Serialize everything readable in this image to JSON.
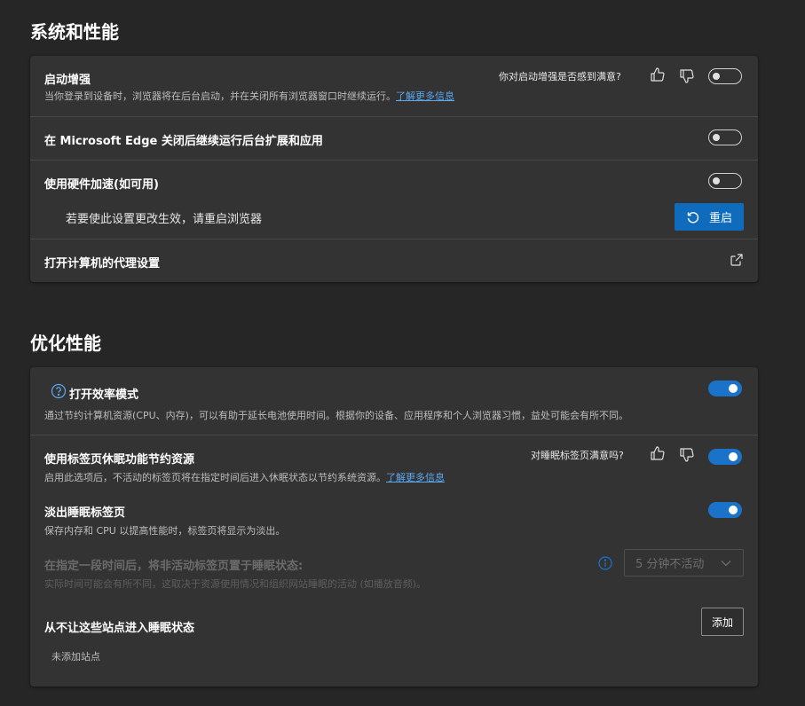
{
  "system": {
    "title": "系统和性能",
    "startup_boost": {
      "title": "启动增强",
      "desc": "当你登录到设备时，浏览器将在后台启动，并在关闭所有浏览器窗口时继续运行。",
      "learn_more": "了解更多信息",
      "feedback_question": "你对启动增强是否感到满意?",
      "toggle_state": "off"
    },
    "background_apps": {
      "title": "在 Microsoft Edge 关闭后继续运行后台扩展和应用",
      "toggle_state": "off"
    },
    "hardware_accel": {
      "title": "使用硬件加速(如可用)",
      "toggle_state": "off",
      "restart_note": "若要使此设置更改生效，请重启浏览器",
      "restart_label": "重启"
    },
    "proxy": {
      "title": "打开计算机的代理设置"
    }
  },
  "perf": {
    "title": "优化性能",
    "efficiency": {
      "title": "打开效率模式",
      "desc": "通过节约计算机资源(CPU、内存)，可以有助于延长电池使用时间。根据你的设备、应用程序和个人浏览器习惯，益处可能会有所不同。",
      "toggle_state": "on"
    },
    "sleeping_tabs": {
      "title": "使用标签页休眠功能节约资源",
      "desc": "启用此选项后，不活动的标签页将在指定时间后进入休眠状态以节约系统资源。",
      "learn_more": "了解更多信息",
      "feedback_question": "对睡眠标签页满意吗?",
      "toggle_state": "on"
    },
    "fade_tabs": {
      "title": "淡出睡眠标签页",
      "desc": "保存内存和 CPU 以提高性能时，标签页将显示为淡出。",
      "toggle_state": "on"
    },
    "sleep_after": {
      "title": "在指定一段时间后，将非活动标签页置于睡眠状态:",
      "desc": "实际时间可能会有所不同，这取决于资源使用情况和组织网站睡眠的活动 (如播放音频)。",
      "selected": "5 分钟不活动"
    },
    "never_sleep": {
      "title": "从不让这些站点进入睡眠状态",
      "add_label": "添加",
      "empty_text": "未添加站点"
    }
  },
  "colors": {
    "accent": "#0f6cbd",
    "toggle_on": "#1a73c9",
    "link": "#5aa9f0",
    "background": "#262626",
    "card": "#333333"
  }
}
